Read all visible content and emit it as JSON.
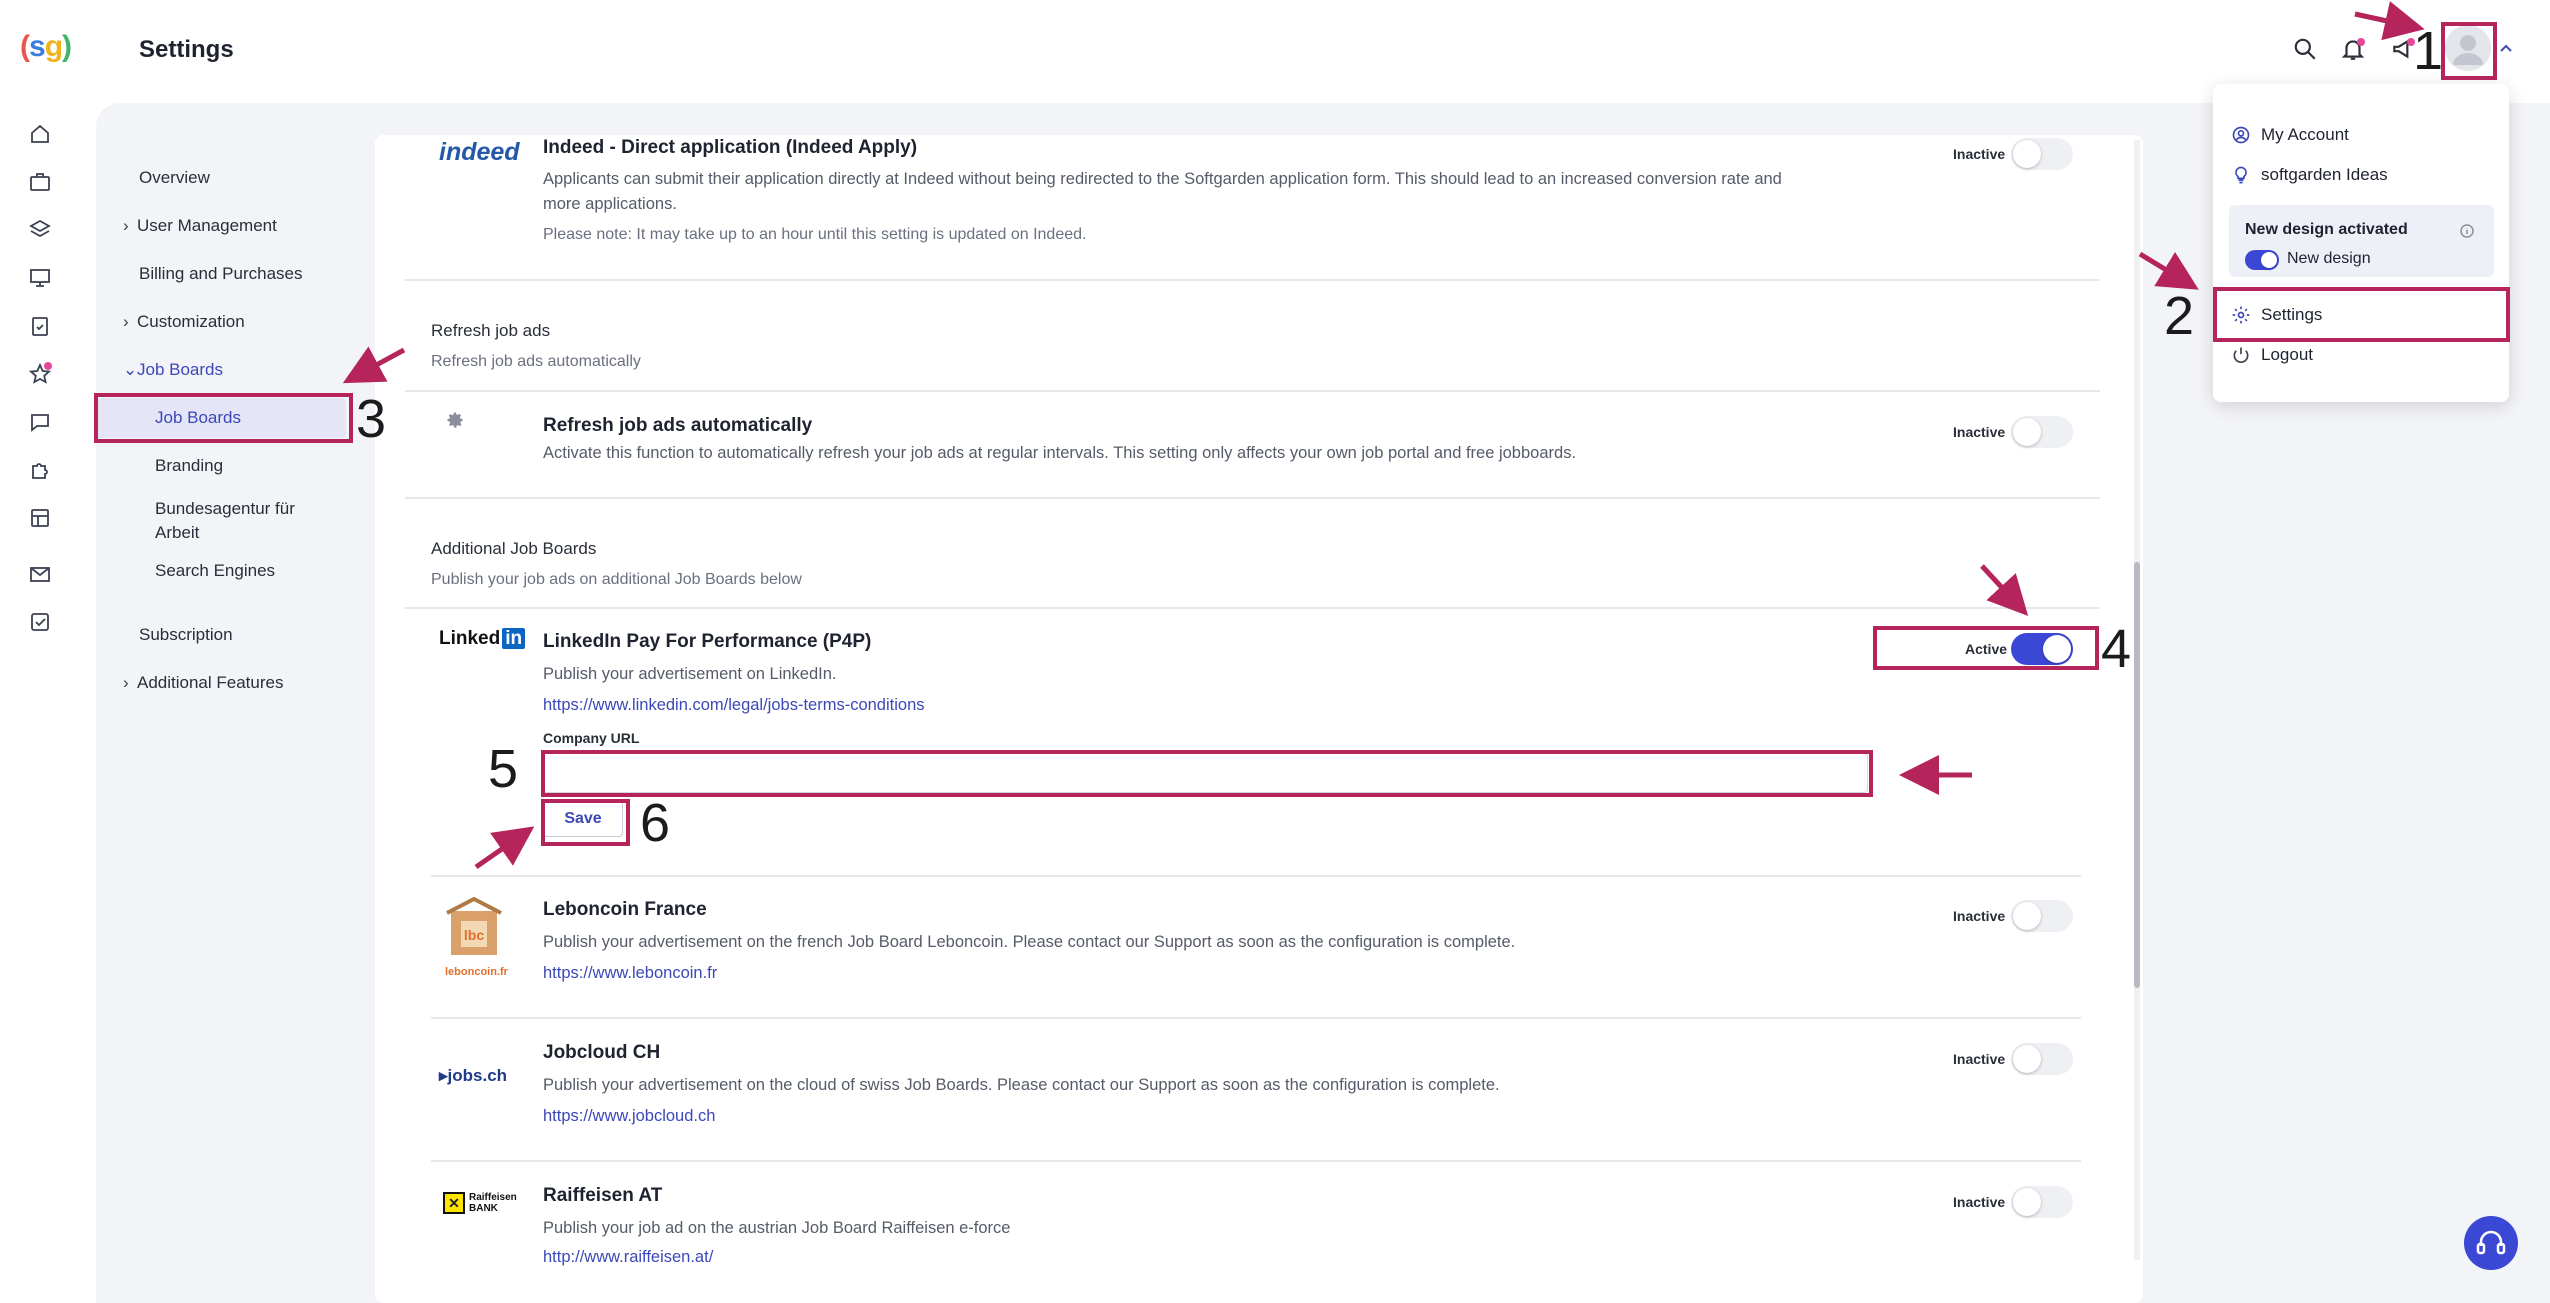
{
  "app": {
    "logo_text": "(sg)",
    "page_title": "Settings"
  },
  "settings_nav": {
    "overview": "Overview",
    "user_management": "User Management",
    "billing": "Billing and Purchases",
    "customization": "Customization",
    "job_boards_group": "Job Boards",
    "job_boards": "Job Boards",
    "branding": "Branding",
    "bundesagentur_1": "Bundesagentur für",
    "bundesagentur_2": "Arbeit",
    "search_engines": "Search Engines",
    "subscription": "Subscription",
    "additional_features": "Additional Features"
  },
  "indeed": {
    "logo": "indeed",
    "title": "Indeed - Direct application (Indeed Apply)",
    "desc_1": "Applicants can submit their application directly at Indeed without being redirected to the Softgarden application form. This should lead to an increased conversion rate and",
    "desc_2": "more applications.",
    "note": "Please note: It may take up to an hour until this setting is updated on Indeed.",
    "status": "Inactive"
  },
  "refresh_section": {
    "title": "Refresh job ads",
    "subtitle": "Refresh job ads automatically"
  },
  "refresh_item": {
    "title": "Refresh job ads automatically",
    "desc": "Activate this function to automatically refresh your job ads at regular intervals. This setting only affects your own job portal and free jobboards.",
    "status": "Inactive"
  },
  "additional_section": {
    "title": "Additional Job Boards",
    "subtitle": "Publish your job ads on additional Job Boards below"
  },
  "linkedin": {
    "logo_text": "Linked",
    "logo_in": "in",
    "title": "LinkedIn Pay For Performance (P4P)",
    "desc": "Publish your advertisement on LinkedIn.",
    "link": "https://www.linkedin.com/legal/jobs-terms-conditions",
    "status": "Active",
    "field_label": "Company URL",
    "field_value": "",
    "save_label": "Save"
  },
  "leboncoin": {
    "logo_caption": "leboncoin.fr",
    "title": "Leboncoin France",
    "desc": "Publish your advertisement on the french Job Board Leboncoin. Please contact our Support as soon as the configuration is complete.",
    "link": "https://www.leboncoin.fr",
    "status": "Inactive"
  },
  "jobcloud": {
    "logo_text": "jobs.ch",
    "title": "Jobcloud CH",
    "desc": "Publish your advertisement on the cloud of swiss Job Boards. Please contact our Support as soon as the configuration is complete.",
    "link": "https://www.jobcloud.ch",
    "status": "Inactive"
  },
  "raiffeisen": {
    "logo_1": "Raiffeisen",
    "logo_2": "BANK",
    "title": "Raiffeisen AT",
    "desc": "Publish your job ad on the austrian Job Board Raiffeisen e-force",
    "link": "http://www.raiffeisen.at/",
    "status": "Inactive"
  },
  "dropdown": {
    "my_account": "My Account",
    "ideas": "softgarden Ideas",
    "new_design_title": "New design activated",
    "new_design_toggle": "New design",
    "settings": "Settings",
    "logout": "Logout"
  },
  "annotations": [
    "1",
    "2",
    "3",
    "4",
    "5",
    "6"
  ],
  "colors": {
    "accent": "#3b48d6",
    "highlight": "#b5245a",
    "notification": "#e5489b"
  }
}
